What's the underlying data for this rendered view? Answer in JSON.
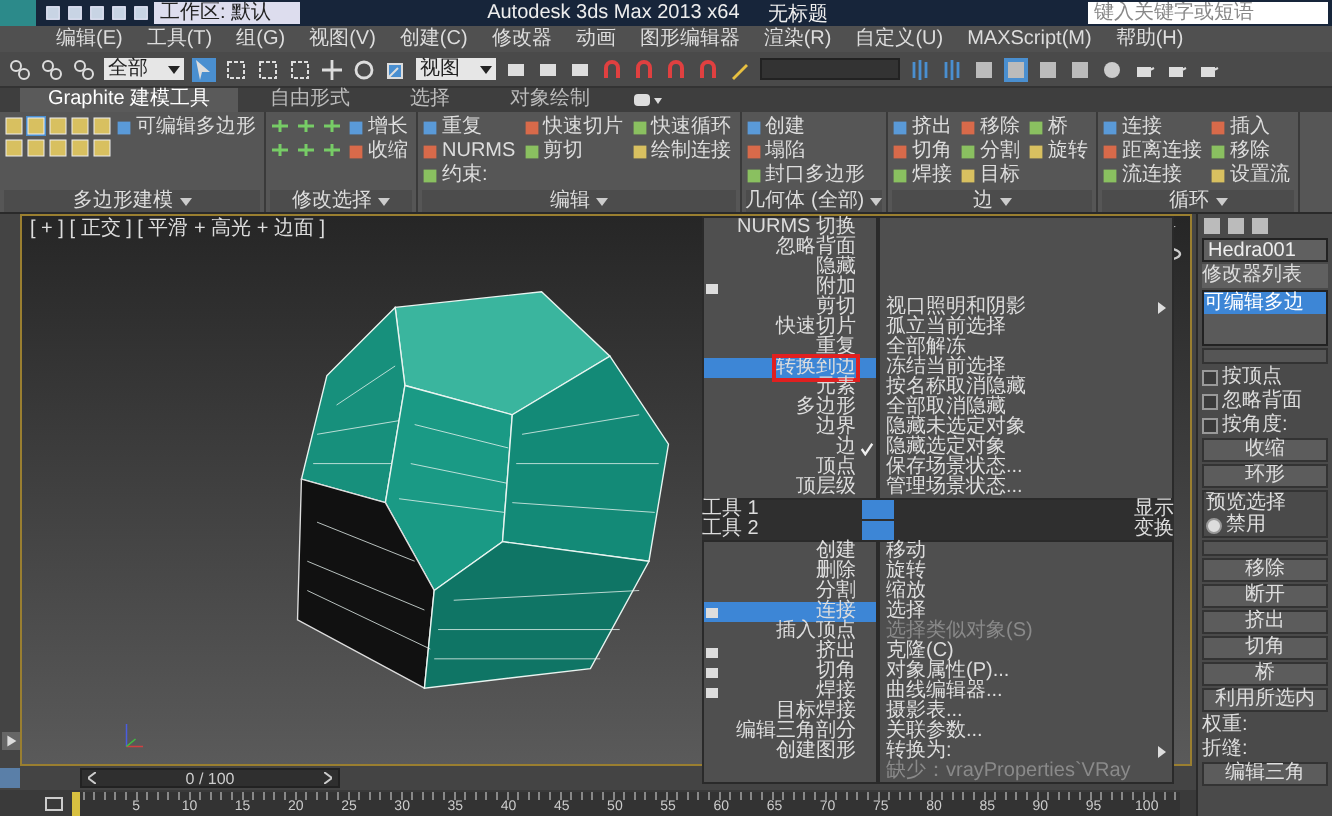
{
  "title_bar": {
    "workspace": "工作区: 默认",
    "title": "Autodesk 3ds Max  2013 x64",
    "document": "无标题",
    "search": {
      "placeholder": "键入关键字或短语"
    }
  },
  "menu_bar": [
    "编辑(E)",
    "工具(T)",
    "组(G)",
    "视图(V)",
    "创建(C)",
    "修改器",
    "动画",
    "图形编辑器",
    "渲染(R)",
    "自定义(U)",
    "MAXScript(M)",
    "帮助(H)"
  ],
  "main_toolbar": {
    "selection_filter": "全部",
    "reference_coordinate": "视图"
  },
  "ribbon": {
    "tabs": [
      {
        "label": "Graphite 建模工具",
        "selected": true
      },
      {
        "label": "自由形式",
        "selected": false
      },
      {
        "label": "选择",
        "selected": false
      },
      {
        "label": "对象绘制",
        "selected": false
      }
    ],
    "groups": [
      {
        "label": "多边形建模",
        "columns": [
          [
            "可编辑多边形"
          ]
        ]
      },
      {
        "label": "修改选择",
        "columns": [
          [
            "增长",
            "收缩"
          ]
        ]
      },
      {
        "label": "编辑",
        "columns": [
          [
            "重复",
            "NURMS",
            "约束:"
          ],
          [
            "快速切片",
            "剪切"
          ],
          [
            "快速循环",
            "绘制连接"
          ]
        ]
      },
      {
        "label": "几何体 (全部)",
        "columns": [
          [
            "创建",
            "塌陷",
            "封口多边形"
          ]
        ]
      },
      {
        "label": "边",
        "columns": [
          [
            "挤出",
            "切角",
            "焊接"
          ],
          [
            "移除",
            "分割",
            "目标"
          ],
          [
            "桥",
            "旋转"
          ]
        ]
      },
      {
        "label": "循环",
        "columns": [
          [
            "连接",
            "距离连接",
            "流连接"
          ],
          [
            "插入",
            "移除",
            "设置流"
          ]
        ]
      }
    ]
  },
  "viewport": {
    "label": "[ + ] [ 正交 ] [ 平滑 + 高光 + 边面 ]"
  },
  "quad_menu": {
    "quadrants": [
      {
        "title": "工具 1",
        "items": [
          {
            "label": "NURMS 切换",
            "selected": false,
            "checked": false,
            "options": false
          },
          {
            "label": "忽略背面",
            "selected": false,
            "checked": false,
            "options": false
          },
          {
            "label": "隐藏",
            "selected": false,
            "checked": false,
            "options": false
          },
          {
            "label": "附加",
            "selected": false,
            "checked": false,
            "options": true
          },
          {
            "label": "剪切",
            "selected": false,
            "checked": false,
            "options": false
          },
          {
            "label": "快速切片",
            "selected": false,
            "checked": false,
            "options": false
          },
          {
            "label": "重复",
            "selected": false,
            "checked": false,
            "options": false
          },
          {
            "label": "转换到边",
            "selected": true,
            "checked": false,
            "options": false
          },
          {
            "label": "元素",
            "selected": false,
            "checked": false,
            "options": false
          },
          {
            "label": "多边形",
            "selected": false,
            "checked": false,
            "options": false
          },
          {
            "label": "边界",
            "selected": false,
            "checked": false,
            "options": false
          },
          {
            "label": "边",
            "selected": false,
            "checked": true,
            "options": false
          },
          {
            "label": "顶点",
            "selected": false,
            "checked": false,
            "options": false
          },
          {
            "label": "顶层级",
            "selected": false,
            "checked": false,
            "options": false
          }
        ]
      },
      {
        "title": "显示",
        "items": [
          {
            "label": "视口照明和阴影",
            "selected": false,
            "submenu": true,
            "disabled": false
          },
          {
            "label": "孤立当前选择",
            "selected": false,
            "submenu": false,
            "disabled": false
          },
          {
            "label": "全部解冻",
            "selected": false,
            "submenu": false,
            "disabled": false
          },
          {
            "label": "冻结当前选择",
            "selected": false,
            "submenu": false,
            "disabled": false
          },
          {
            "label": "按名称取消隐藏",
            "selected": false,
            "submenu": false,
            "disabled": false
          },
          {
            "label": "全部取消隐藏",
            "selected": false,
            "submenu": false,
            "disabled": false
          },
          {
            "label": "隐藏未选定对象",
            "selected": false,
            "submenu": false,
            "disabled": false
          },
          {
            "label": "隐藏选定对象",
            "selected": false,
            "submenu": false,
            "disabled": false
          },
          {
            "label": "保存场景状态...",
            "selected": false,
            "submenu": false,
            "disabled": false
          },
          {
            "label": "管理场景状态...",
            "selected": false,
            "submenu": false,
            "disabled": false
          }
        ]
      },
      {
        "title": "工具 2",
        "items": [
          {
            "label": "创建",
            "selected": false,
            "checked": false,
            "options": false
          },
          {
            "label": "删除",
            "selected": false,
            "checked": false,
            "options": false
          },
          {
            "label": "分割",
            "selected": false,
            "checked": false,
            "options": false
          },
          {
            "label": "连接",
            "selected": true,
            "checked": false,
            "options": true
          },
          {
            "label": "插入顶点",
            "selected": false,
            "checked": false,
            "options": false
          },
          {
            "label": "挤出",
            "selected": false,
            "checked": false,
            "options": true
          },
          {
            "label": "切角",
            "selected": false,
            "checked": false,
            "options": true
          },
          {
            "label": "焊接",
            "selected": false,
            "checked": false,
            "options": true
          },
          {
            "label": "目标焊接",
            "selected": false,
            "checked": false,
            "options": false
          },
          {
            "label": "编辑三角剖分",
            "selected": false,
            "checked": false,
            "options": false
          },
          {
            "label": "创建图形",
            "selected": false,
            "checked": false,
            "options": false
          }
        ]
      },
      {
        "title": "变换",
        "items": [
          {
            "label": "移动",
            "selected": false,
            "submenu": false,
            "disabled": false
          },
          {
            "label": "旋转",
            "selected": false,
            "submenu": false,
            "disabled": false
          },
          {
            "label": "缩放",
            "selected": false,
            "submenu": false,
            "disabled": false
          },
          {
            "label": "选择",
            "selected": false,
            "submenu": false,
            "disabled": false
          },
          {
            "label": "选择类似对象(S)",
            "selected": false,
            "submenu": false,
            "disabled": true
          },
          {
            "label": "克隆(C)",
            "selected": false,
            "submenu": false,
            "disabled": false
          },
          {
            "label": "对象属性(P)...",
            "selected": false,
            "submenu": false,
            "disabled": false
          },
          {
            "label": "曲线编辑器...",
            "selected": false,
            "submenu": false,
            "disabled": false
          },
          {
            "label": "摄影表...",
            "selected": false,
            "submenu": false,
            "disabled": false
          },
          {
            "label": "关联参数...",
            "selected": false,
            "submenu": false,
            "disabled": false
          },
          {
            "label": "转换为:",
            "selected": false,
            "submenu": true,
            "disabled": false
          },
          {
            "label": "缺少：vrayProperties`VRay",
            "selected": false,
            "submenu": false,
            "disabled": true
          }
        ]
      }
    ]
  },
  "command_panel": {
    "object_name": "Hedra001",
    "modifier_list": "修改器列表",
    "stack": [
      {
        "label": "可编辑多边",
        "selected": true
      }
    ],
    "selection_options": [
      {
        "label": "按顶点",
        "checked": false
      },
      {
        "label": "忽略背面",
        "checked": false
      },
      {
        "label": "按角度:",
        "checked": false
      }
    ],
    "selection_buttons": [
      "收缩",
      "环形"
    ],
    "preview": {
      "title": "预览选择",
      "options": [
        {
          "label": "禁用",
          "selected": true
        }
      ]
    },
    "edit_buttons": [
      "移除",
      "断开",
      "挤出",
      "切角",
      "桥",
      "利用所选内"
    ],
    "weight_label": "权重:",
    "crease_label": "折缝:",
    "bottom_button": "编辑三角"
  },
  "timeline": {
    "counter": "0 / 100",
    "level": 0,
    "ticks": [
      "5",
      "10",
      "15",
      "20",
      "25",
      "30",
      "35",
      "40",
      "45",
      "50",
      "55",
      "60",
      "65",
      "70",
      "75",
      "80",
      "85",
      "90",
      "95",
      "100"
    ]
  }
}
